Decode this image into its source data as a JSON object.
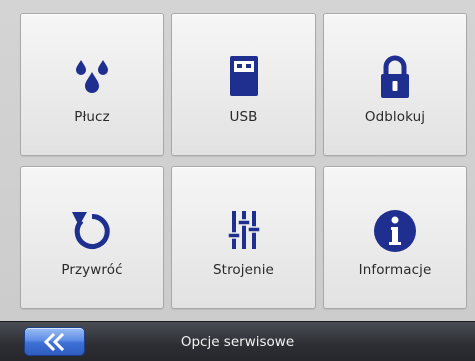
{
  "colors": {
    "icon": "#1e2f8f",
    "bar_background": "#2c2e33",
    "back_button": "#3d6fd4",
    "tile_background": "#ececec"
  },
  "tiles": [
    {
      "label": "Płucz",
      "icon": "water-drops-icon"
    },
    {
      "label": "USB",
      "icon": "usb-drive-icon"
    },
    {
      "label": "Odblokuj",
      "icon": "padlock-icon"
    },
    {
      "label": "Przywróć",
      "icon": "restore-icon"
    },
    {
      "label": "Strojenie",
      "icon": "sliders-icon"
    },
    {
      "label": "Informacje",
      "icon": "info-icon"
    }
  ],
  "bottom_bar": {
    "title": "Opcje serwisowe",
    "back_icon": "double-chevron-left-icon"
  }
}
